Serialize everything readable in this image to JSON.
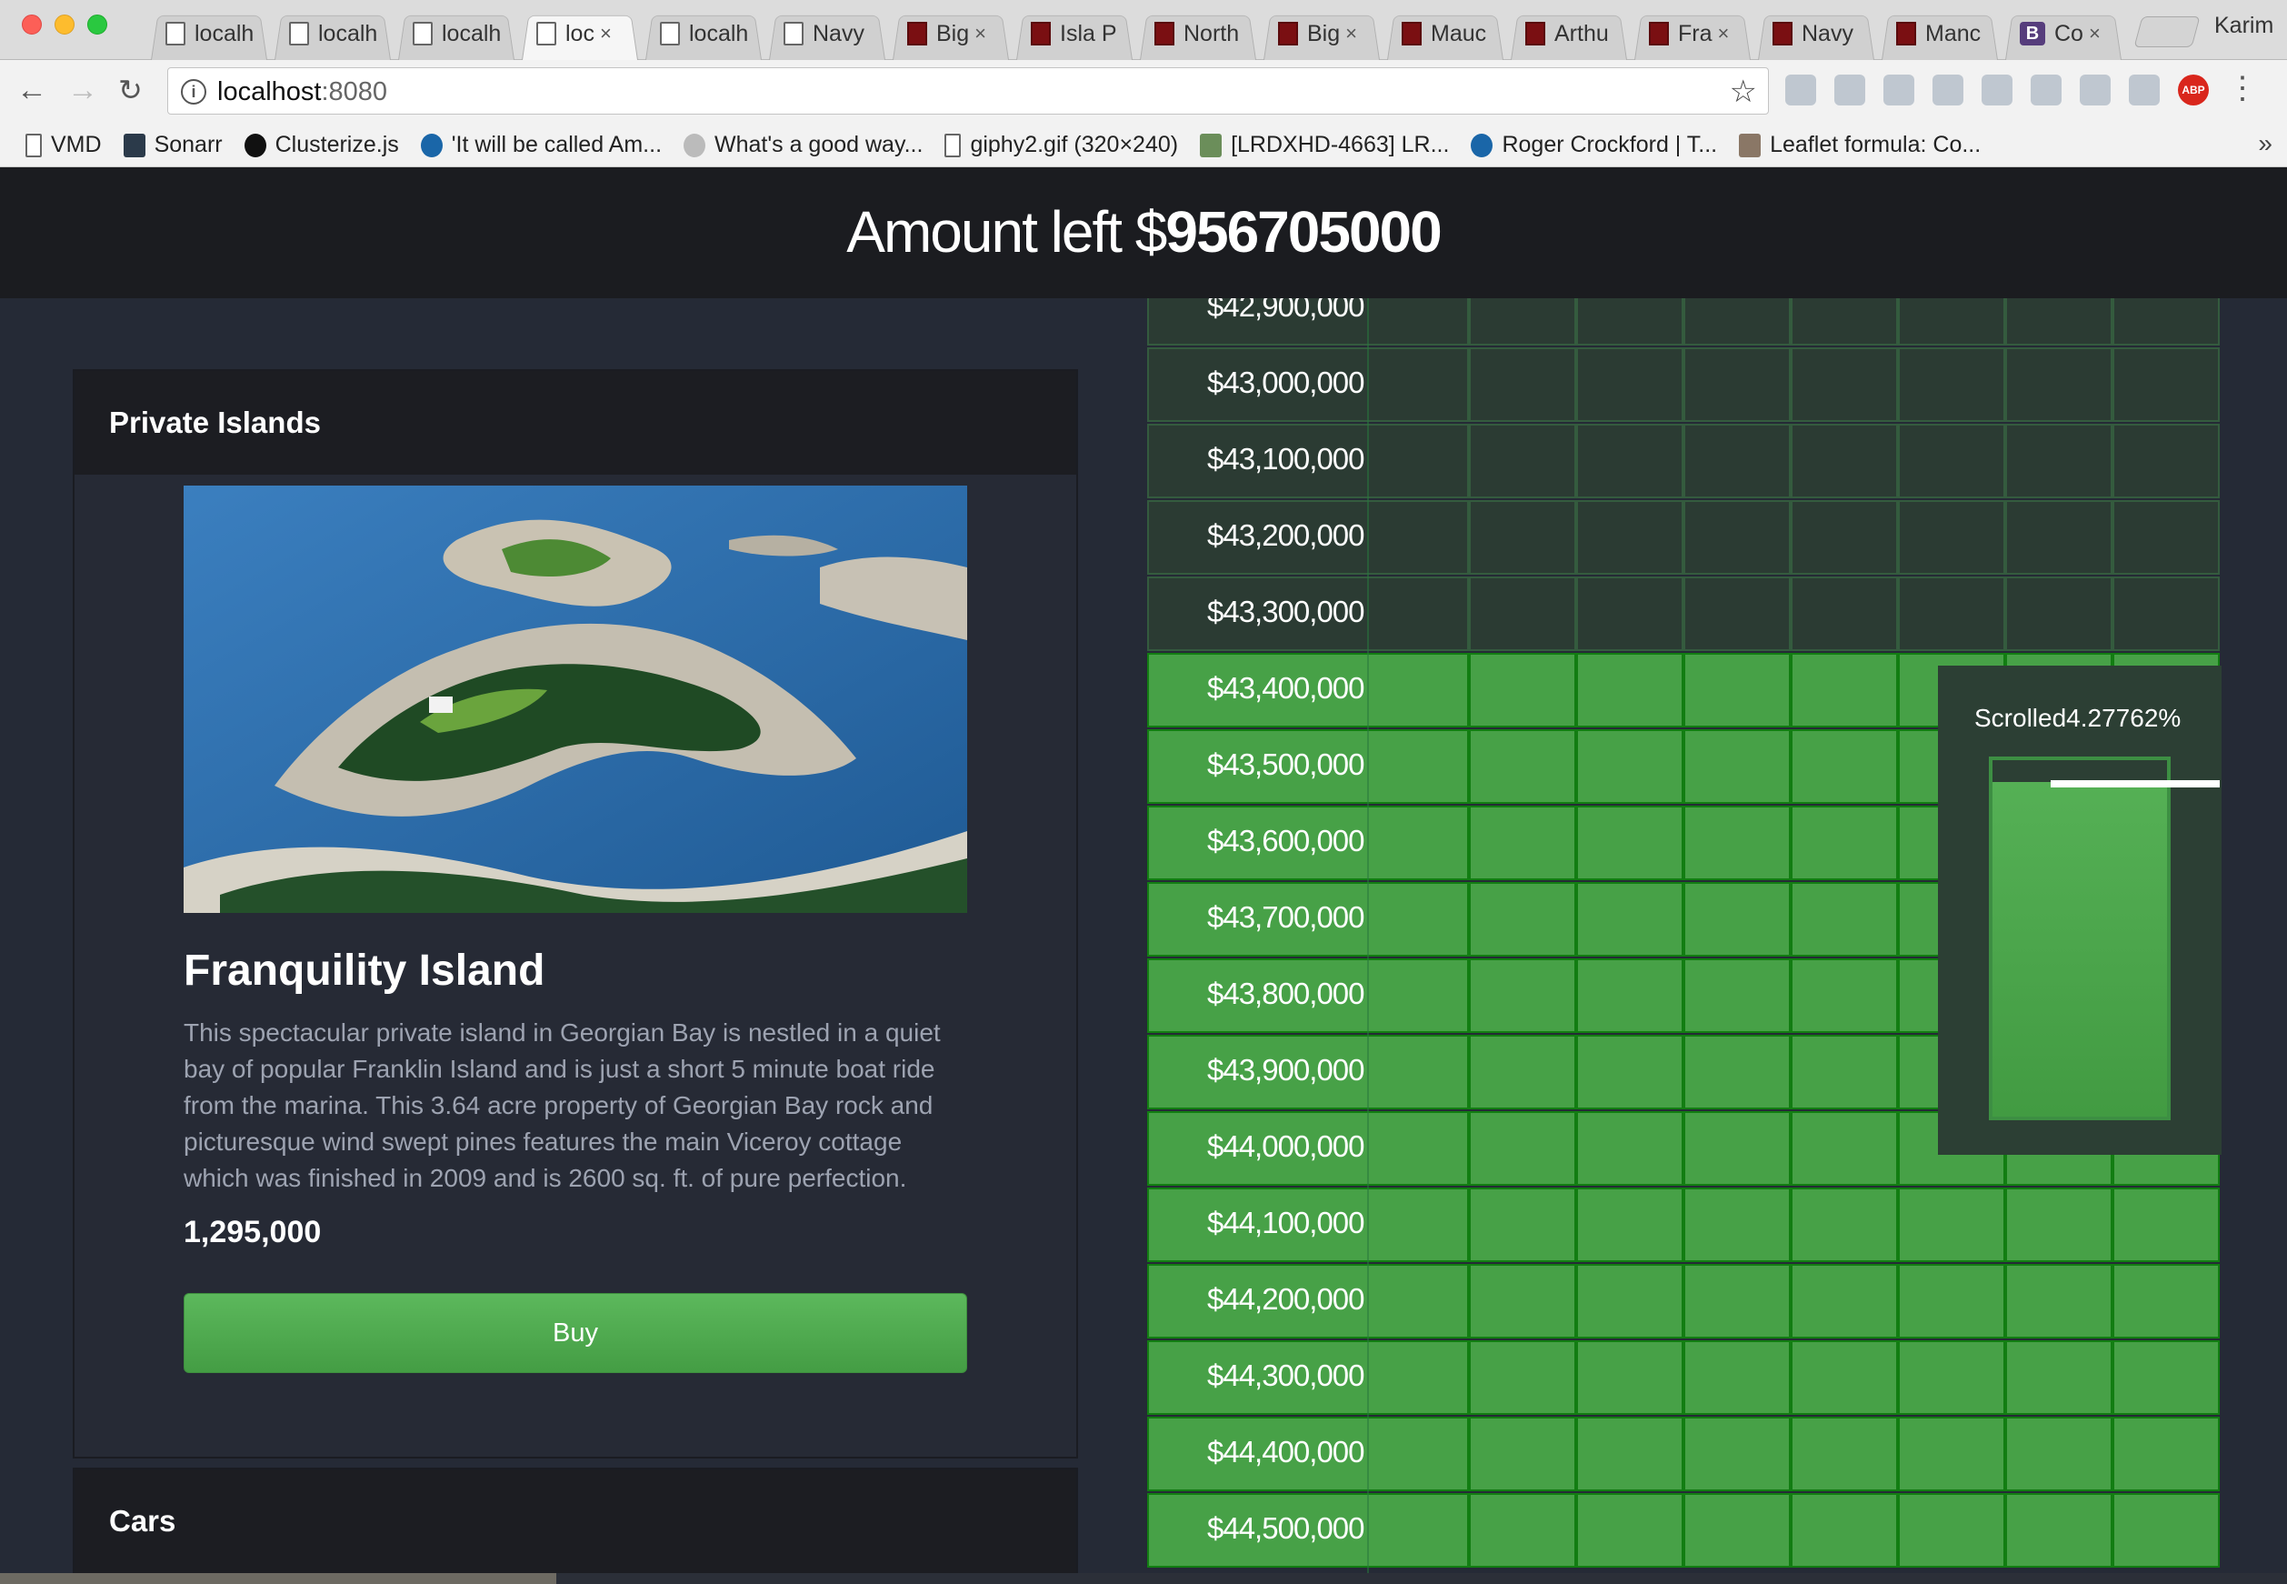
{
  "browser": {
    "tabs": [
      {
        "label": "localh",
        "icon": "page-icon",
        "active": false,
        "close": false
      },
      {
        "label": "localh",
        "icon": "page-icon",
        "active": false,
        "close": false
      },
      {
        "label": "localh",
        "icon": "page-icon",
        "active": false,
        "close": false
      },
      {
        "label": "loc",
        "icon": "page-icon",
        "active": true,
        "close": true
      },
      {
        "label": "localh",
        "icon": "page-icon",
        "active": false,
        "close": false
      },
      {
        "label": "Navy",
        "icon": "page-icon",
        "active": false,
        "close": false
      },
      {
        "label": "Big",
        "icon": "brick-icon",
        "active": false,
        "close": true
      },
      {
        "label": "Isla P",
        "icon": "brick-icon",
        "active": false,
        "close": false
      },
      {
        "label": "North",
        "icon": "brick-icon",
        "active": false,
        "close": false
      },
      {
        "label": "Big",
        "icon": "brick-icon",
        "active": false,
        "close": true
      },
      {
        "label": "Mauc",
        "icon": "brick-icon",
        "active": false,
        "close": false
      },
      {
        "label": "Arthu",
        "icon": "brick-icon",
        "active": false,
        "close": false
      },
      {
        "label": "Fra",
        "icon": "brick-icon",
        "active": false,
        "close": true
      },
      {
        "label": "Navy",
        "icon": "brick-icon",
        "active": false,
        "close": false
      },
      {
        "label": "Manc",
        "icon": "brick-icon",
        "active": false,
        "close": false
      },
      {
        "label": "Co",
        "icon": "bootstrap-icon",
        "active": false,
        "close": true
      }
    ],
    "bootstrap_glyph": "B",
    "close_glyph": "×",
    "profile": "Karim",
    "url_host": "localhost",
    "url_port": ":8080",
    "bookmarks": [
      {
        "label": "VMD",
        "icon": "page"
      },
      {
        "label": "Sonarr",
        "icon": "dark"
      },
      {
        "label": "Clusterize.js",
        "icon": "gh"
      },
      {
        "label": "'It will be called Am...",
        "icon": "blue"
      },
      {
        "label": "What's a good way...",
        "icon": "grey"
      },
      {
        "label": "giphy2.gif (320×240)",
        "icon": "page"
      },
      {
        "label": "[LRDXHD-4663] LR...",
        "icon": "green"
      },
      {
        "label": "Roger Crockford | T...",
        "icon": "blue"
      },
      {
        "label": "Leaflet formula: Co...",
        "icon": "photo"
      }
    ],
    "extensions": [
      "window-icon",
      "ublock-icon",
      "feather-icon",
      "css-icon",
      "printer-icon",
      "react-icon",
      "circle-icon",
      "d-icon",
      "abp-icon",
      "menu-icon"
    ],
    "abp_label": "ABP"
  },
  "header": {
    "amount_prefix": "Amount left $",
    "amount_value": "956705000"
  },
  "category": {
    "title": "Private Islands"
  },
  "item": {
    "title": "Franquility Island",
    "description": "This spectacular private island in Georgian Bay is nestled in a quiet bay of popular Franklin Island and is just a short 5 minute boat ride from the marina. This 3.64 acre property of Georgian Bay rock and picturesque wind swept pines features the main Viceroy cottage which was finished in 2009 and is 2600 sq. ft. of pure perfection.",
    "price": "1,295,000",
    "buy_label": "Buy"
  },
  "next_category": {
    "title": "Cars"
  },
  "grid": {
    "rows": [
      {
        "label": "$42,900,000",
        "state": "dim"
      },
      {
        "label": "$43,000,000",
        "state": "dim"
      },
      {
        "label": "$43,100,000",
        "state": "dim"
      },
      {
        "label": "$43,200,000",
        "state": "dim"
      },
      {
        "label": "$43,300,000",
        "state": "dim"
      },
      {
        "label": "$43,400,000",
        "state": "lit"
      },
      {
        "label": "$43,500,000",
        "state": "lit"
      },
      {
        "label": "$43,600,000",
        "state": "lit"
      },
      {
        "label": "$43,700,000",
        "state": "lit"
      },
      {
        "label": "$43,800,000",
        "state": "lit"
      },
      {
        "label": "$43,900,000",
        "state": "lit"
      },
      {
        "label": "$44,000,000",
        "state": "lit"
      },
      {
        "label": "$44,100,000",
        "state": "lit"
      },
      {
        "label": "$44,200,000",
        "state": "lit"
      },
      {
        "label": "$44,300,000",
        "state": "lit"
      },
      {
        "label": "$44,400,000",
        "state": "lit"
      },
      {
        "label": "$44,500,000",
        "state": "lit"
      }
    ],
    "cells_per_row": 8
  },
  "scroll": {
    "label_prefix": "Scrolled",
    "percent_text": "4.27762%",
    "fill_fraction": 0.94
  },
  "colors": {
    "lit": "#47a147",
    "dim": "#2b3b33",
    "header": "#1b1c20",
    "page": "#252a36"
  }
}
